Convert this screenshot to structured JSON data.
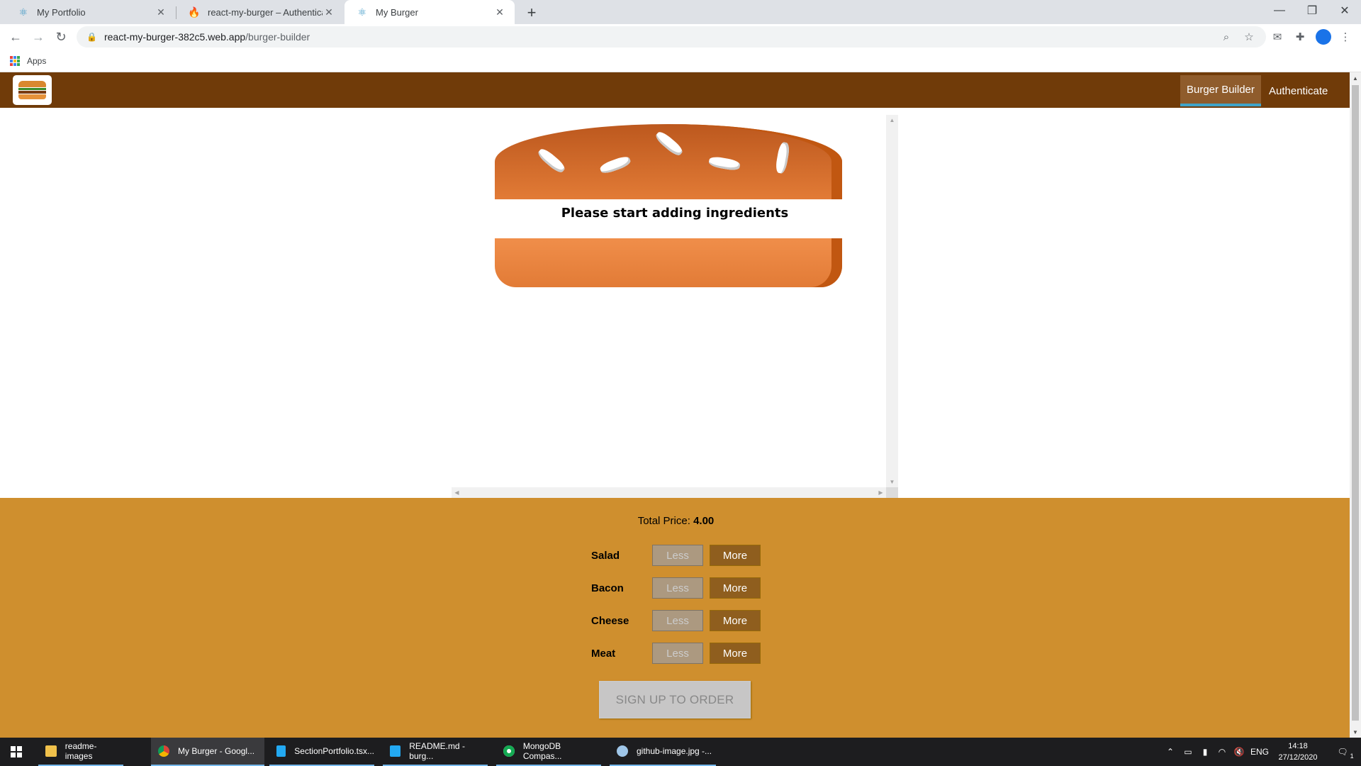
{
  "browser": {
    "tabs": [
      {
        "title": "My Portfolio",
        "icon": "react-icon"
      },
      {
        "title": "react-my-burger – Authentication",
        "icon": "firebase-icon"
      },
      {
        "title": "My Burger",
        "icon": "react-icon"
      }
    ],
    "url_host": "react-my-burger-382c5.web.app",
    "url_path": "/burger-builder",
    "bookmarks_apps": "Apps"
  },
  "app": {
    "nav": [
      {
        "label": "Burger Builder",
        "active": true
      },
      {
        "label": "Authenticate",
        "active": false
      }
    ],
    "burger_message": "Please start adding ingredients",
    "total_price_label": "Total Price:",
    "total_price_value": "4.00",
    "less_label": "Less",
    "more_label": "More",
    "ingredients": [
      "Salad",
      "Bacon",
      "Cheese",
      "Meat"
    ],
    "order_button": "SIGN UP TO ORDER",
    "colors": {
      "header": "#703b09",
      "controls_bg": "#cf8f2e",
      "more_button": "#8f5e1e",
      "less_button": "#ac9980",
      "bread": "#e27b36"
    }
  },
  "taskbar": {
    "items": [
      {
        "label": "readme-images",
        "icon": "folder-icon"
      },
      {
        "label": "My Burger - Googl...",
        "icon": "chrome-icon"
      },
      {
        "label": "SectionPortfolio.tsx...",
        "icon": "vscode-icon"
      },
      {
        "label": "README.md - burg...",
        "icon": "vscode-icon"
      },
      {
        "label": "MongoDB Compas...",
        "icon": "mongodb-icon"
      },
      {
        "label": "github-image.jpg -...",
        "icon": "paint-icon"
      }
    ],
    "language": "ENG",
    "time": "14:18",
    "date": "27/12/2020",
    "notifications": "1"
  }
}
